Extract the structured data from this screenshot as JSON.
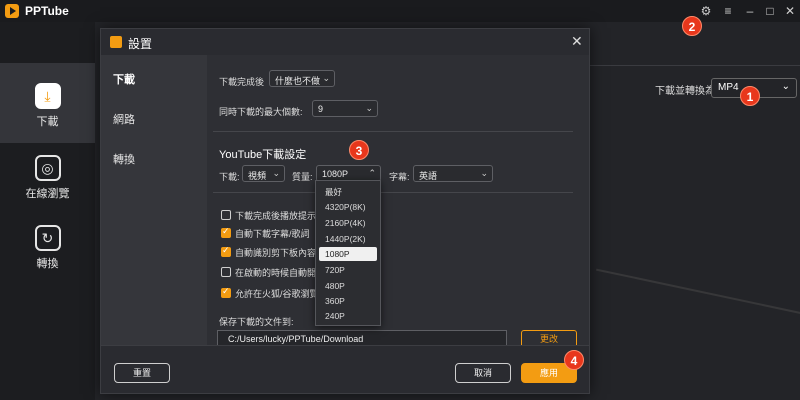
{
  "app": {
    "title": "PPTube"
  },
  "window_controls": {
    "settings_icon": "gear-icon",
    "menu": "≡",
    "minimize": "–",
    "maximize": "□",
    "close": "✕"
  },
  "sidebar": {
    "items": [
      {
        "label": "下載",
        "icon": "download-icon"
      },
      {
        "label": "在線瀏覽",
        "icon": "globe-icon"
      },
      {
        "label": "轉換",
        "icon": "convert-icon"
      }
    ]
  },
  "main": {
    "convert_label": "下載並轉換為",
    "convert_value": "MP4"
  },
  "badges": [
    "1",
    "2",
    "3",
    "4"
  ],
  "dialog": {
    "title": "設置",
    "nav": [
      "下載",
      "網路",
      "轉換"
    ],
    "after_download_label": "下載完成後",
    "after_download_value": "什麼也不做",
    "max_downloads_label": "同時下載的最大個數:",
    "max_downloads_value": "9",
    "youtube_section": "YouTube下載設定",
    "download_label": "下載:",
    "download_value": "視頻",
    "quality_label": "質量:",
    "quality_value": "1080P",
    "subtitle_label": "字幕:",
    "subtitle_value": "英語",
    "quality_options": [
      "最好",
      "4320P(8K)",
      "2160P(4K)",
      "1440P(2K)",
      "1080P",
      "720P",
      "480P",
      "360P",
      "240P"
    ],
    "checkboxes": [
      {
        "label": "下載完成後播放提示音",
        "checked": false
      },
      {
        "label": "自動下載字幕/歌詞",
        "checked": true
      },
      {
        "label": "自動識別剪下板內容",
        "checked": true
      },
      {
        "label": "在啟動的時候自動開始",
        "checked": false
      },
      {
        "label": "允許在火狐/谷歌瀏覽器",
        "checked": true
      }
    ],
    "save_path_label": "保存下載的文件到:",
    "save_path_value": "C:/Users/lucky/PPTube/Download",
    "change_button": "更改",
    "reset_button": "重置",
    "cancel_button": "取消",
    "apply_button": "應用"
  }
}
